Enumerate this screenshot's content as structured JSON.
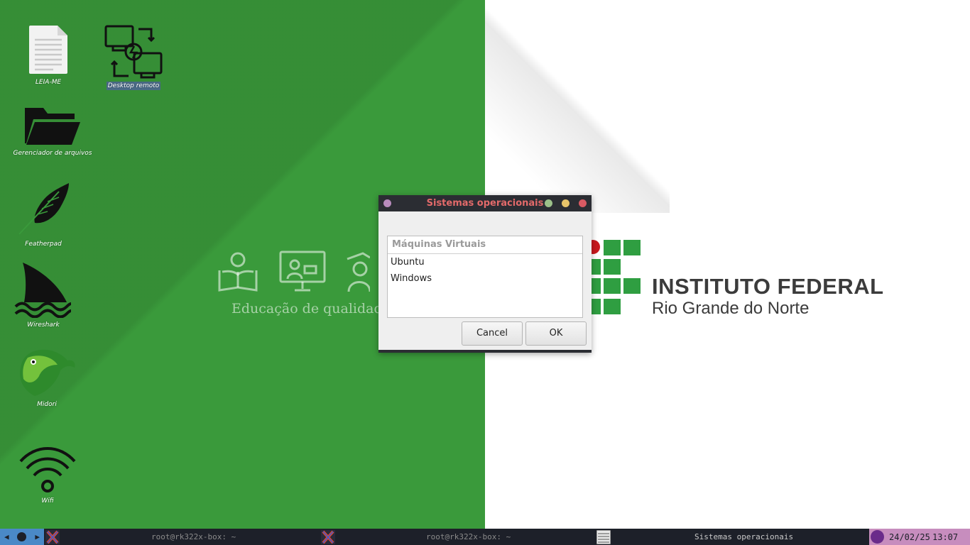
{
  "desktop": {
    "icons": [
      {
        "label": "LEIA-ME",
        "icon": "text-file-icon"
      },
      {
        "label": "Desktop remoto",
        "icon": "remote-desktop-icon"
      },
      {
        "label": "Gerenciador de arquivos",
        "icon": "folder-icon"
      },
      {
        "label": "Featherpad",
        "icon": "feather-icon"
      },
      {
        "label": "Wireshark",
        "icon": "shark-fin-icon"
      },
      {
        "label": "Midori",
        "icon": "midori-icon"
      },
      {
        "label": "Wifi",
        "icon": "wifi-icon"
      }
    ]
  },
  "wallpaper": {
    "tagline": "Educação de qualidade",
    "institution_title": "INSTITUTO FEDERAL",
    "institution_subtitle": "Rio Grande do Norte",
    "colors": {
      "green": "#3a9a3b",
      "logo_red": "#c8191e",
      "logo_green": "#2f9e41"
    }
  },
  "dialog": {
    "title": "Sistemas operacionais",
    "list_header": "Máquinas Virtuais",
    "options": [
      "Ubuntu",
      "Windows"
    ],
    "cancel_label": "Cancel",
    "ok_label": "OK",
    "titlebar_colors": {
      "menu": "#b98bbd",
      "minimize": "#9cc18a",
      "maximize": "#e8c46a",
      "close": "#d95a63"
    }
  },
  "taskbar": {
    "tasks": [
      {
        "label": "root@rk322x-box: ~",
        "icon": "x-terminal-icon"
      },
      {
        "label": "root@rk322x-box: ~",
        "icon": "x-terminal-icon"
      },
      {
        "label": "Sistemas operacionais",
        "icon": "list-window-icon"
      }
    ],
    "date": "24/02/25",
    "time": "13:07"
  }
}
